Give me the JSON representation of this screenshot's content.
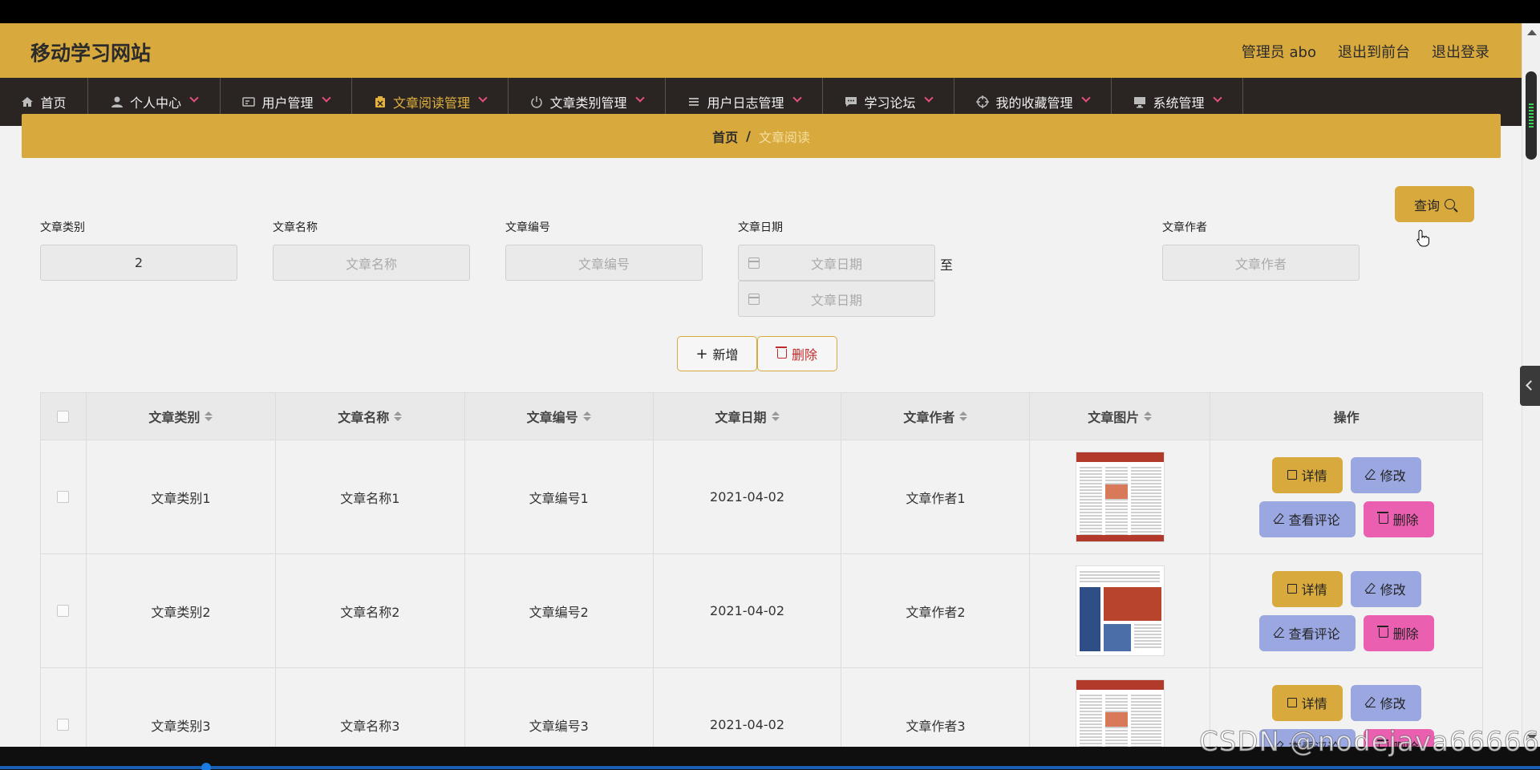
{
  "header": {
    "site_title": "移动学习网站",
    "admin": "管理员 abo",
    "to_front": "退出到前台",
    "logout": "退出登录"
  },
  "nav": {
    "items": [
      {
        "label": "首页",
        "icon": "home-icon",
        "dropdown": false
      },
      {
        "label": "个人中心",
        "icon": "user-icon",
        "dropdown": true
      },
      {
        "label": "用户管理",
        "icon": "id-card-icon",
        "dropdown": true
      },
      {
        "label": "文章阅读管理",
        "icon": "clipboard-icon",
        "dropdown": true,
        "active": true
      },
      {
        "label": "文章类别管理",
        "icon": "power-icon",
        "dropdown": true
      },
      {
        "label": "用户日志管理",
        "icon": "list-icon",
        "dropdown": true
      },
      {
        "label": "学习论坛",
        "icon": "chat-icon",
        "dropdown": true
      },
      {
        "label": "我的收藏管理",
        "icon": "target-icon",
        "dropdown": true
      },
      {
        "label": "系统管理",
        "icon": "monitor-icon",
        "dropdown": true
      }
    ]
  },
  "breadcrumb": {
    "home": "首页",
    "separator": "/",
    "current": "文章阅读"
  },
  "search": {
    "category_label": "文章类别",
    "category_value": "2",
    "name_label": "文章名称",
    "name_placeholder": "文章名称",
    "number_label": "文章编号",
    "number_placeholder": "文章编号",
    "date_label": "文章日期",
    "date_start_placeholder": "文章日期",
    "date_end_placeholder": "文章日期",
    "to_text": "至",
    "author_label": "文章作者",
    "author_placeholder": "文章作者",
    "query_label": "查询"
  },
  "actions": {
    "add_label": "新增",
    "delete_label": "删除"
  },
  "table": {
    "headers": [
      "文章类别",
      "文章名称",
      "文章编号",
      "文章日期",
      "文章作者",
      "文章图片",
      "操作"
    ],
    "rows": [
      {
        "category": "文章类别1",
        "name": "文章名称1",
        "number": "文章编号1",
        "date": "2021-04-02",
        "author": "文章作者1"
      },
      {
        "category": "文章类别2",
        "name": "文章名称2",
        "number": "文章编号2",
        "date": "2021-04-02",
        "author": "文章作者2"
      },
      {
        "category": "文章类别3",
        "name": "文章名称3",
        "number": "文章编号3",
        "date": "2021-04-02",
        "author": "文章作者3"
      }
    ],
    "ops": {
      "detail": "详情",
      "edit": "修改",
      "comment": "查看评论",
      "delete": "删除"
    }
  },
  "watermark": "CSDN @nodejava666666",
  "colors": {
    "accent": "#d8a93d",
    "nav_bg": "#2a2523",
    "edit_btn": "#9aa7e0",
    "delete_btn": "#ea5fb0"
  }
}
